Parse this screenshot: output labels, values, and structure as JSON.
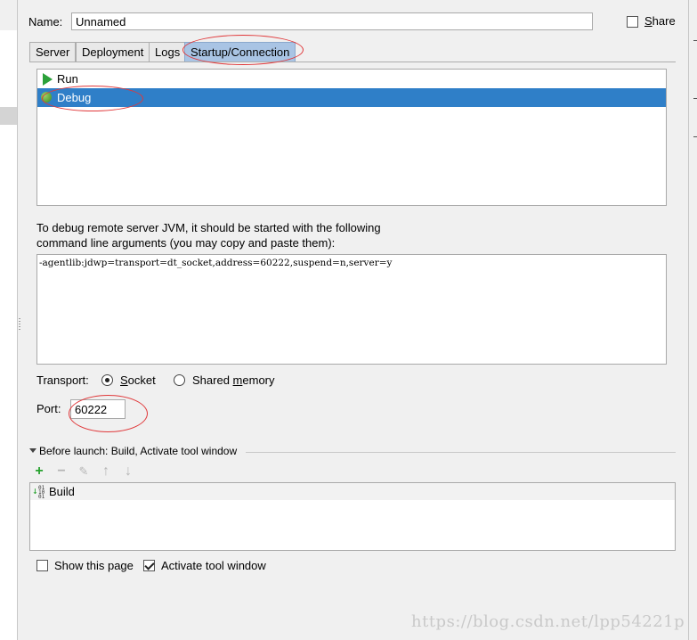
{
  "form": {
    "name_label": "Name:",
    "name_value": "Unnamed",
    "share_label": "Share",
    "share_checked": false
  },
  "tabs": [
    {
      "label": "Server",
      "active": false
    },
    {
      "label": "Deployment",
      "active": false
    },
    {
      "label": "Logs",
      "active": false
    },
    {
      "label": "Startup/Connection",
      "active": true
    }
  ],
  "startup": {
    "items": [
      {
        "label": "Run",
        "icon": "run-icon",
        "selected": false
      },
      {
        "label": "Debug",
        "icon": "debug-icon",
        "selected": true
      }
    ],
    "hint_line1": "To debug remote server JVM, it should be started with the following",
    "hint_line2": "command line arguments (you may copy and paste them):",
    "args": "-agentlib:jdwp=transport=dt_socket,address=60222,suspend=n,server=y",
    "transport_label": "Transport:",
    "transport_options": [
      {
        "label": "Socket",
        "checked": true
      },
      {
        "label": "Shared memory",
        "checked": false
      }
    ],
    "port_label": "Port:",
    "port_value": "60222"
  },
  "before_launch": {
    "header": "Before launch: Build, Activate tool window",
    "toolbar_icons": [
      "add-icon",
      "remove-icon",
      "edit-icon",
      "move-up-icon",
      "move-down-icon"
    ],
    "tasks": [
      {
        "label": "Build",
        "icon": "build-icon"
      }
    ],
    "show_page_label": "Show this page",
    "show_page_checked": false,
    "activate_label": "Activate tool window",
    "activate_checked": true
  },
  "watermark": "https://blog.csdn.net/lpp54221p",
  "colors": {
    "selection": "#2f7fc8",
    "active_tab": "#a9c4e4",
    "annotation": "#e0383a",
    "run_green": "#2ba13a"
  }
}
